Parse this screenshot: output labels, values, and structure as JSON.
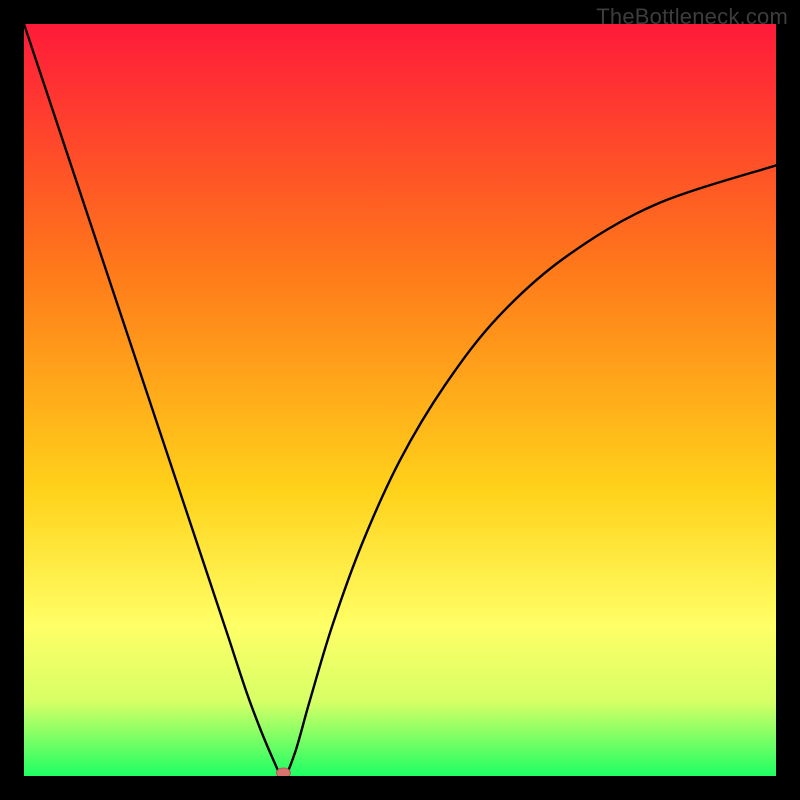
{
  "watermark": "TheBottleneck.com",
  "colors": {
    "border": "#000000",
    "gradient_top": "#ff1a3a",
    "gradient_mid1": "#ff7a1a",
    "gradient_mid2": "#ffd21a",
    "gradient_band": "#ffff66",
    "gradient_low": "#d8ff66",
    "gradient_bottom": "#1eff64",
    "curve": "#000000",
    "marker_fill": "#d6736f",
    "marker_stroke": "#b55a56"
  },
  "chart_data": {
    "type": "line",
    "title": "",
    "xlabel": "",
    "ylabel": "",
    "xlim": [
      0,
      100
    ],
    "ylim": [
      0,
      100
    ],
    "grid": false,
    "series": [
      {
        "name": "bottleneck-curve",
        "x": [
          0,
          3,
          6,
          9,
          12,
          15,
          18,
          21,
          24,
          27,
          30,
          33,
          34.5,
          36,
          38,
          41,
          45,
          50,
          56,
          63,
          72,
          84,
          100
        ],
        "y": [
          100,
          91,
          82,
          73,
          64,
          55,
          46,
          37,
          28,
          19,
          10,
          2.5,
          0,
          3,
          10,
          20,
          31,
          42,
          52,
          61,
          69,
          76,
          81.2
        ]
      }
    ],
    "marker": {
      "x": 34.5,
      "y": 0
    },
    "gradient_stops": [
      {
        "offset": 0.0,
        "color": "#ff1a3a"
      },
      {
        "offset": 0.33,
        "color": "#ff7a1a"
      },
      {
        "offset": 0.62,
        "color": "#ffd21a"
      },
      {
        "offset": 0.8,
        "color": "#ffff66"
      },
      {
        "offset": 0.9,
        "color": "#d8ff66"
      },
      {
        "offset": 1.0,
        "color": "#1eff64"
      }
    ]
  }
}
